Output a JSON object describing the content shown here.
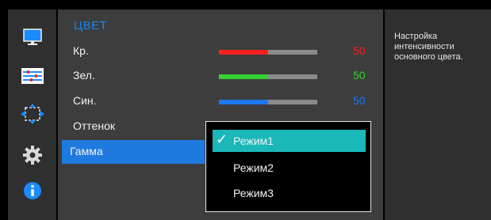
{
  "sidebar": {
    "items": [
      {
        "icon": "monitor-icon"
      },
      {
        "icon": "color-settings-icon",
        "active": true
      },
      {
        "icon": "resize-icon"
      },
      {
        "icon": "gear-icon"
      },
      {
        "icon": "info-icon"
      }
    ]
  },
  "section": {
    "title": "ЦВЕТ"
  },
  "settings": [
    {
      "label": "Кр.",
      "value": "50",
      "level": 0.5,
      "color": "#ff2020"
    },
    {
      "label": "Зел.",
      "value": "50",
      "level": 0.5,
      "color": "#33d233"
    },
    {
      "label": "Син.",
      "value": "50",
      "level": 0.5,
      "color": "#1e78f0"
    },
    {
      "label": "Оттенок"
    },
    {
      "label": "Гамма",
      "selected": true
    }
  ],
  "dropdown": {
    "options": [
      {
        "label": "Режим1",
        "selected": true
      },
      {
        "label": "Режим2"
      },
      {
        "label": "Режим3"
      }
    ],
    "checkmark": "✓"
  },
  "info": {
    "text": "Настройка интенсивности основного цвета."
  },
  "colors": {
    "accent": "#1a85e8",
    "highlight": "#1f7ae0",
    "dropdown_selected": "#1ab8b8"
  }
}
